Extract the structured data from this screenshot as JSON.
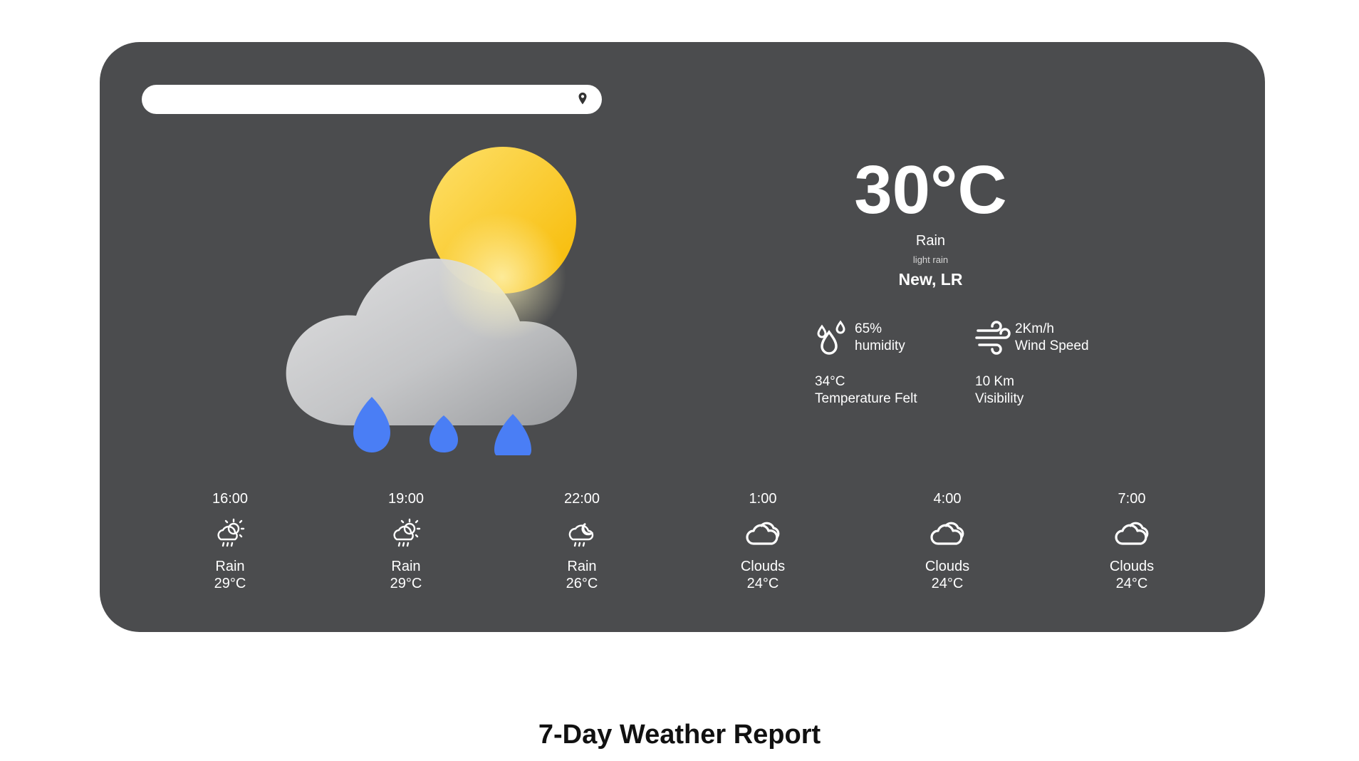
{
  "search": {
    "placeholder": "",
    "icon": "location-pin-icon"
  },
  "current": {
    "temperature": "30°C",
    "condition": "Rain",
    "description": "light rain",
    "location": "New, LR",
    "icon": "cloud-sun-rain-icon"
  },
  "stats": {
    "humidity": {
      "value": "65%",
      "label": "humidity",
      "icon": "humidity-drops-icon"
    },
    "wind": {
      "value": "2Km/h",
      "label": "Wind Speed",
      "icon": "wind-icon"
    },
    "feels": {
      "value": "34°C",
      "label": "Temperature Felt"
    },
    "visibility": {
      "value": "10 Km",
      "label": "Visibility"
    }
  },
  "forecast": [
    {
      "time": "16:00",
      "condition": "Rain",
      "temp": "29°C",
      "icon": "sun-cloud-rain-icon"
    },
    {
      "time": "19:00",
      "condition": "Rain",
      "temp": "29°C",
      "icon": "sun-cloud-rain-icon"
    },
    {
      "time": "22:00",
      "condition": "Rain",
      "temp": "26°C",
      "icon": "moon-cloud-rain-icon"
    },
    {
      "time": "1:00",
      "condition": "Clouds",
      "temp": "24°C",
      "icon": "clouds-icon"
    },
    {
      "time": "4:00",
      "condition": "Clouds",
      "temp": "24°C",
      "icon": "clouds-icon"
    },
    {
      "time": "7:00",
      "condition": "Clouds",
      "temp": "24°C",
      "icon": "clouds-icon"
    }
  ],
  "report_title": "7-Day Weather Report",
  "colors": {
    "card": "#4b4c4e",
    "raindrop": "#4a7ef5",
    "sun": "#f8c81e"
  }
}
